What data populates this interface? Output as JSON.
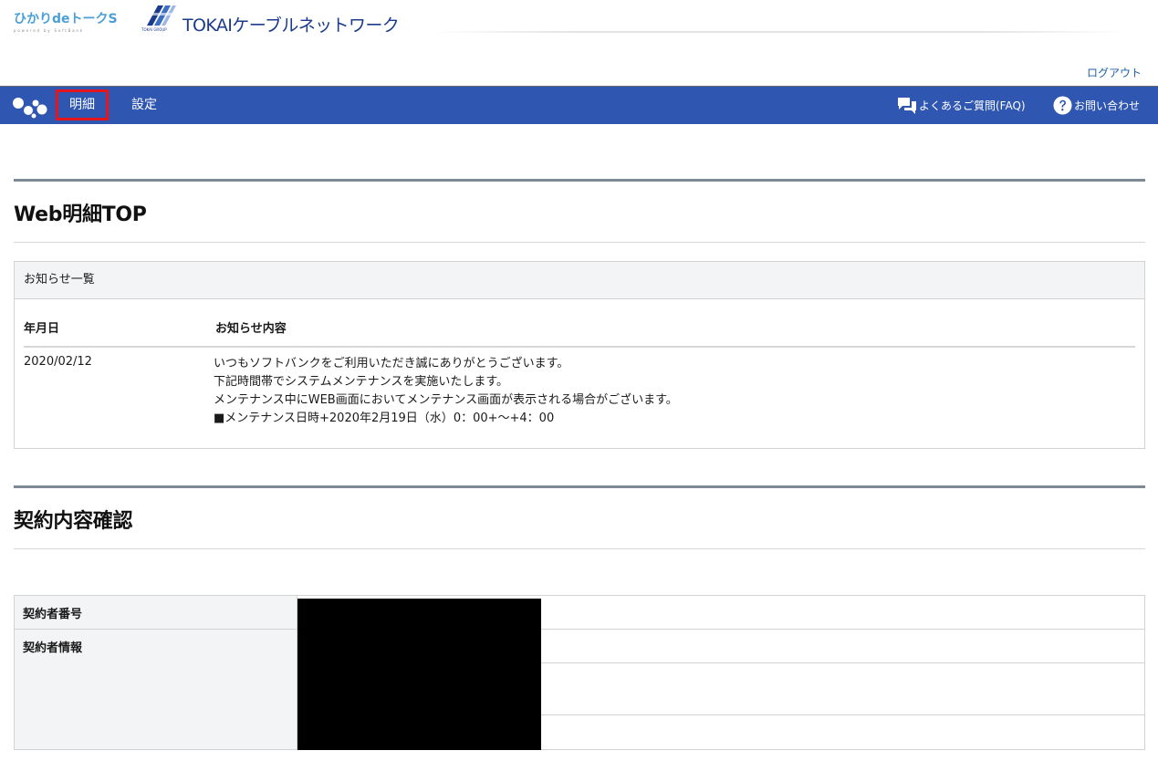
{
  "header": {
    "logo_hikari": "ひかりdeトークS",
    "logo_hikari_sub": "powered by SoftBank",
    "logo_tokai_group": "TOKAI GROUP",
    "logo_tokai_name": "TOKAIケーブルネットワーク",
    "logout": "ログアウト"
  },
  "nav": {
    "menu_icon": "dots-logo-icon",
    "items": [
      {
        "label": "明細",
        "active": true
      },
      {
        "label": "設定",
        "active": false
      }
    ],
    "faq": {
      "label": "よくあるご質問(FAQ)",
      "icon": "chat-bubbles-icon"
    },
    "contact": {
      "label": "お問い合わせ",
      "icon": "question-circle-icon"
    },
    "colors": {
      "bar": "#2f56b0",
      "active_border": "#e8141b"
    }
  },
  "web_top": {
    "title": "Web明細TOP",
    "notice": {
      "heading": "お知らせ一覧",
      "columns": [
        "年月日",
        "お知らせ内容"
      ],
      "rows": [
        {
          "date": "2020/02/12",
          "lines": [
            "いつもソフトバンクをご利用いただき誠にありがとうございます。",
            "下記時間帯でシステムメンテナンスを実施いたします。",
            "メンテナンス中にWEB画面においてメンテナンス画面が表示される場合がございます。",
            "■メンテナンス日時+2020年2月19日（水）0：00+～+4：00"
          ]
        }
      ]
    }
  },
  "contract": {
    "title": "契約内容確認",
    "rows": [
      {
        "label": "契約者番号"
      },
      {
        "label": "契約者情報"
      }
    ]
  }
}
